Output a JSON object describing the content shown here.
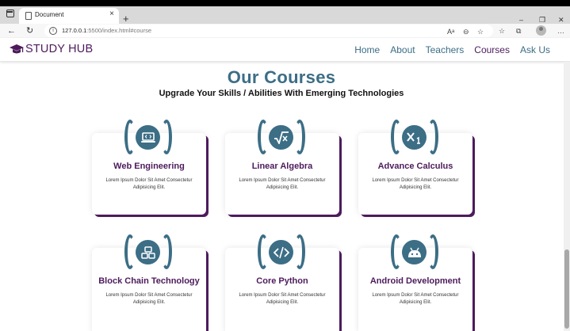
{
  "browser": {
    "tab_title": "Document",
    "tab_close": "×",
    "new_tab": "+",
    "url_host": "127.0.0.1",
    "url_path": ":5500/index.html#course",
    "window_controls": {
      "minimize": "–",
      "restore": "❐",
      "close": "✕"
    },
    "nav_icons": {
      "back": "←",
      "reload": "↻"
    },
    "toolbar_icons": [
      "read-aloud-icon",
      "zoom-icon",
      "favorite-add-icon",
      "favorites-icon",
      "collections-icon",
      "profile-icon",
      "more-icon"
    ]
  },
  "site": {
    "logo_text": "STUDY HUB",
    "nav": [
      "Home",
      "About",
      "Teachers",
      "Courses",
      "Ask Us"
    ],
    "active_nav": "Courses"
  },
  "section": {
    "heading": "Our Courses",
    "subheading": "Upgrade Your Skills / Abilities With Emerging Technologies"
  },
  "courses": [
    {
      "title": "Web Engineering",
      "desc_line1": "Lorem Ipsum Dolor Sit Amet Consectetur",
      "desc_line2": "Adipisicing Elit.",
      "icon": "laptop-code-icon"
    },
    {
      "title": "Linear Algebra",
      "desc_line1": "Lorem Ipsum Dolor Sit Amet Consectetur",
      "desc_line2": "Adipisicing Elit.",
      "icon": "square-root-icon"
    },
    {
      "title": "Advance Calculus",
      "desc_line1": "Lorem Ipsum Dolor Sit Amet Consectetur",
      "desc_line2": "Adipisicing Elit.",
      "icon": "subscript-icon"
    },
    {
      "title": "Block Chain Technology",
      "desc_line1": "Lorem Ipsum Dolor Sit Amet Consectetur",
      "desc_line2": "Adipisicing Elit.",
      "icon": "cubes-icon"
    },
    {
      "title": "Core Python",
      "desc_line1": "Lorem Ipsum Dolor Sit Amet Consectetur",
      "desc_line2": "Adipisicing Elit.",
      "icon": "code-icon"
    },
    {
      "title": "Android Development",
      "desc_line1": "Lorem Ipsum Dolor Sit Amet Consectetur",
      "desc_line2": "Adipisicing Elit.",
      "icon": "android-icon"
    }
  ],
  "colors": {
    "brand_purple": "#4d1b5c",
    "accent_teal": "#3c6e86"
  }
}
